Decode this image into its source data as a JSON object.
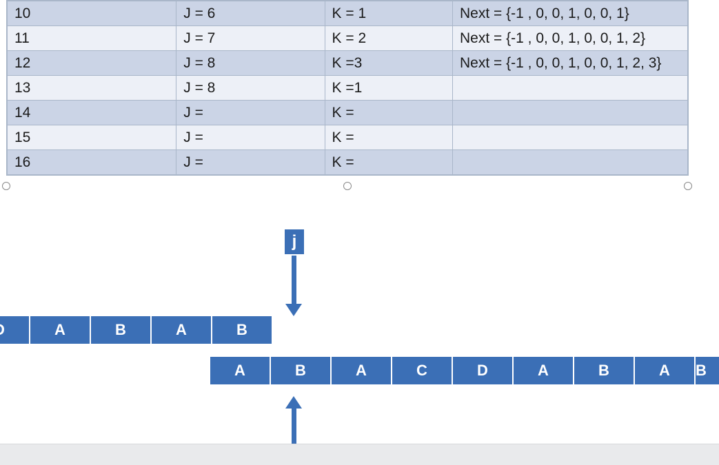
{
  "table": {
    "rows": [
      {
        "c1": "10",
        "c2": "J = 6",
        "c3": "K = 1",
        "c4": "Next = {-1 , 0, 0, 1, 0, 0, 1}"
      },
      {
        "c1": "11",
        "c2": "J = 7",
        "c3": "K = 2",
        "c4": "Next = {-1 , 0, 0, 1, 0, 0, 1, 2}"
      },
      {
        "c1": "12",
        "c2": "J = 8",
        "c3": "K =3",
        "c4": "Next = {-1 , 0, 0, 1, 0, 0, 1, 2, 3}"
      },
      {
        "c1": "13",
        "c2": "J = 8",
        "c3": "K =1",
        "c4": ""
      },
      {
        "c1": "14",
        "c2": "J =",
        "c3": "K =",
        "c4": ""
      },
      {
        "c1": "15",
        "c2": "J =",
        "c3": "K =",
        "c4": ""
      },
      {
        "c1": "16",
        "c2": "J =",
        "c3": "K =",
        "c4": ""
      }
    ]
  },
  "pointer_label": "j",
  "top_strip": [
    "",
    "D",
    "A",
    "B",
    "A",
    "B"
  ],
  "bot_strip": [
    "A",
    "B",
    "A",
    "C",
    "D",
    "A",
    "B",
    "A",
    "B"
  ],
  "colors": {
    "accent": "#3b6fb6",
    "row_odd": "#cbd4e6",
    "row_even": "#edf0f7"
  }
}
